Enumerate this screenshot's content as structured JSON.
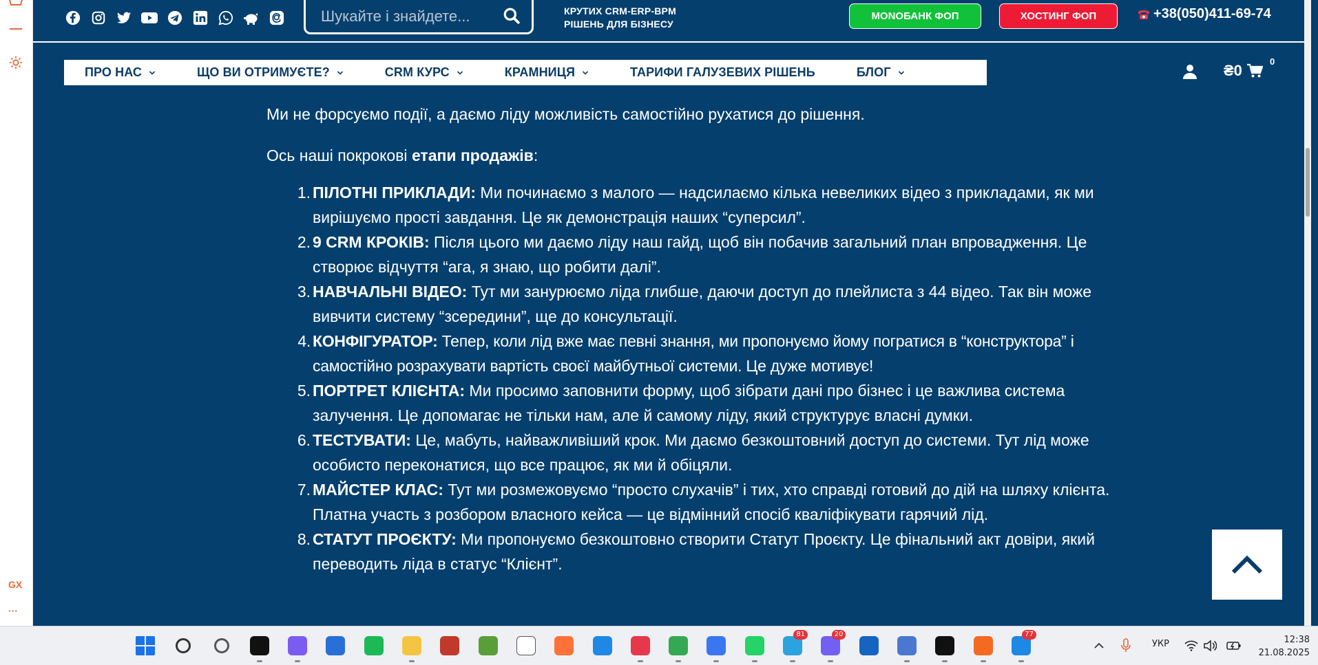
{
  "browser_sidebar": {
    "gx_label": "GX",
    "more_label": "···"
  },
  "topbar": {
    "search": {
      "placeholder": "Шукайте і знайдете..."
    },
    "tagline_line1": "КРУТИХ CRM-ERP-BPM",
    "tagline_line2": "РІШЕНЬ ДЛЯ БІЗНЕСУ",
    "monobank_label": "MONOБАНК ФОП",
    "hosting_label": "ХОСТИНГ ФОП",
    "phone": "+38(050)411-69-74",
    "social_icons": [
      "facebook-icon",
      "instagram-icon",
      "twitter-icon",
      "youtube-icon",
      "telegram-icon",
      "linkedin-icon",
      "whatsapp-icon",
      "piggybank-icon",
      "threads-icon"
    ],
    "colors": {
      "bg": "#053f6e",
      "monobank": "#12c13a",
      "hosting": "#ee1b35"
    }
  },
  "nav": {
    "items": [
      {
        "label": "ПРО НАС",
        "has_dropdown": true
      },
      {
        "label": "ЩО ВИ ОТРИМУЄТЕ?",
        "has_dropdown": true
      },
      {
        "label": "CRM КУРС",
        "has_dropdown": true
      },
      {
        "label": "КРАМНИЦЯ",
        "has_dropdown": true
      },
      {
        "label": "ТАРИФИ ГАЛУЗЕВИХ РІШЕНЬ",
        "has_dropdown": false
      },
      {
        "label": "БЛОГ",
        "has_dropdown": true
      }
    ],
    "cart_total": "₴0",
    "cart_count": "0"
  },
  "content": {
    "intro": "Ми не форсуємо події, а даємо ліду можливість самостійно рухатися до рішення.",
    "steps_lead_prefix": "Ось наші покрокові ",
    "steps_lead_bold": "етапи продажів",
    "steps_lead_suffix": ":",
    "steps": [
      {
        "num": "1.",
        "title": "ПІЛОТНІ ПРИКЛАДИ:",
        "text": " Ми починаємо з малого — надсилаємо кілька невеликих відео з прикладами, як ми вирішуємо прості завдання. Це як демонстрація наших “суперсил”."
      },
      {
        "num": "2.",
        "title": "9 CRM КРОКІВ:",
        "text": " Після цього ми даємо ліду наш гайд, щоб він побачив загальний план впровадження. Це створює відчуття “ага, я знаю, що робити далі”."
      },
      {
        "num": "3.",
        "title": "НАВЧАЛЬНІ ВІДЕО:",
        "text": " Тут ми занурюємо ліда глибше, даючи доступ до плейлиста з 44 відео. Так він може вивчити систему “зсередини”, ще до консультації."
      },
      {
        "num": "4.",
        "title": "КОНФІГУРАТОР:",
        "text": " Тепер, коли лід вже має певні знання, ми пропонуємо йому погратися в “конструктора” і самостійно розрахувати вартість своєї майбутньої системи. Це дуже мотивує!"
      },
      {
        "num": "5.",
        "title": "ПОРТРЕТ КЛІЄНТА:",
        "text": " Ми просимо заповнити форму, щоб зібрати дані про бізнес і це важлива система залучення. Це допомагає не тільки нам, але й самому ліду, який структурує власні думки."
      },
      {
        "num": "6.",
        "title": "ТЕСТУВАТИ:",
        "text": " Це, мабуть, найважливіший крок. Ми даємо безкоштовний доступ до системи. Тут лід може особисто переконатися, що все працює, як ми й обіцяли."
      },
      {
        "num": "7.",
        "title": "МАЙСТЕР КЛАС:",
        "text": " Тут ми розмежовуємо “просто слухачів” і тих, хто справді готовий до дій на шляху клієнта. Платна участь з розбором власного кейса — це відмінний спосіб кваліфікувати гарячий лід."
      },
      {
        "num": "8.",
        "title": "СТАТУТ ПРОЄКТУ:",
        "text": " Ми пропонуємо безкоштовно створити Статут Проєкту. Це фінальний акт довіри, який переводить ліда в статус “Клієнт”."
      }
    ]
  },
  "taskbar": {
    "apps": [
      {
        "name": "windows-start-icon",
        "color": "#1a73e8"
      },
      {
        "name": "search-icon",
        "color": "#333333"
      },
      {
        "name": "camera-icon",
        "color": "#555555"
      },
      {
        "name": "chatgpt-icon",
        "color": "#111111"
      },
      {
        "name": "copilot-icon",
        "color": "#7b5cf0"
      },
      {
        "name": "store-icon",
        "color": "#2a6fd8"
      },
      {
        "name": "spotify-icon",
        "color": "#1db954"
      },
      {
        "name": "folder-icon",
        "color": "#f4c542"
      },
      {
        "name": "app-red-icon",
        "color": "#c0392b"
      },
      {
        "name": "image-editor-icon",
        "color": "#5a9e3a"
      },
      {
        "name": "document-icon",
        "color": "#ffffff"
      },
      {
        "name": "firefox-icon",
        "color": "#ff7139"
      },
      {
        "name": "edge-icon",
        "color": "#1e88e5"
      },
      {
        "name": "opera-icon",
        "color": "#e8364b"
      },
      {
        "name": "chrome-icon",
        "color": "#34a853"
      },
      {
        "name": "signal-icon",
        "color": "#3a76f0"
      },
      {
        "name": "whatsapp-icon",
        "color": "#25d366"
      },
      {
        "name": "telegram-icon",
        "color": "#2aa3df",
        "badge": "81"
      },
      {
        "name": "viber-icon",
        "color": "#7360f2",
        "badge": "20"
      },
      {
        "name": "arrow-app-icon",
        "color": "#1565c0"
      },
      {
        "name": "b-app-icon",
        "color": "#4a78d0"
      },
      {
        "name": "record-icon",
        "color": "#111111"
      },
      {
        "name": "speedometer-icon",
        "color": "#f26b21"
      },
      {
        "name": "mail-icon",
        "color": "#1e88e5",
        "badge": "77"
      }
    ],
    "language": "УКР",
    "time": "12:38",
    "date": "21.08.2025"
  }
}
